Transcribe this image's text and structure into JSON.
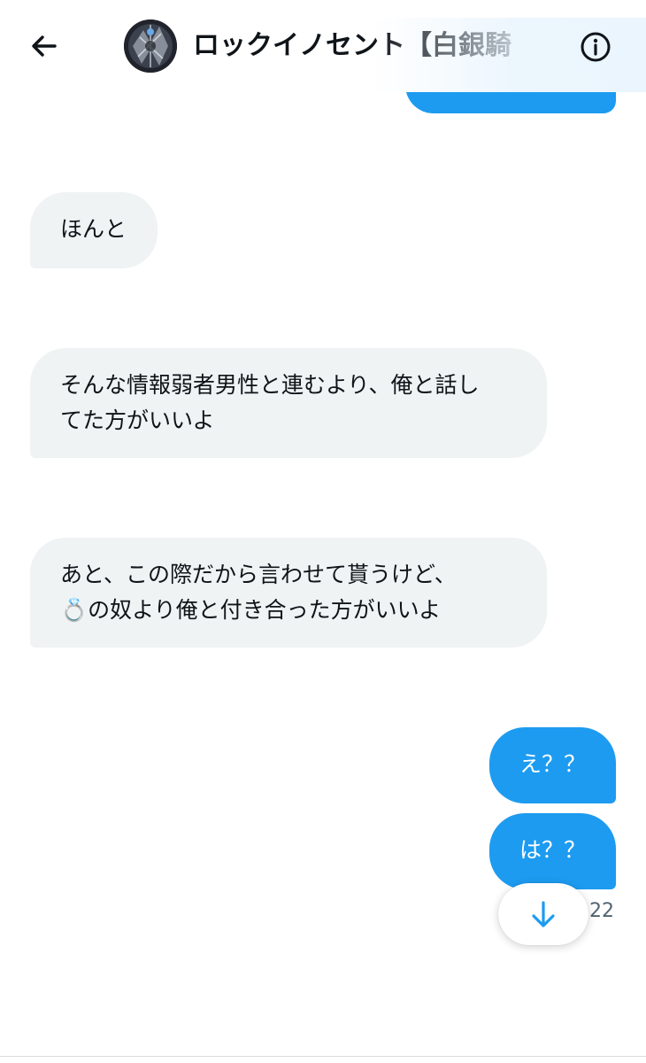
{
  "header": {
    "title": "ロックイノセント【白銀騎",
    "back_icon": "arrow-left-icon",
    "info_icon": "info-circle-icon"
  },
  "messages": [
    {
      "direction": "received",
      "text": "ほんと"
    },
    {
      "direction": "received",
      "text": "そんな情報弱者男性と連むより、俺と話し\nてた方がいいよ"
    },
    {
      "direction": "received",
      "text": "あと、この際だから言わせて貰うけど、\n💍の奴より俺と付き合った方がいいよ"
    },
    {
      "direction": "sent",
      "text": "え？？"
    },
    {
      "direction": "sent",
      "text": "は？？"
    }
  ],
  "timestamp": "22",
  "scroll_button": {
    "icon": "arrow-down-icon"
  },
  "colors": {
    "sent_bubble": "#1d9bf0",
    "received_bubble": "#eff3f4",
    "accent": "#1d9bf0",
    "text": "#0f1419"
  }
}
